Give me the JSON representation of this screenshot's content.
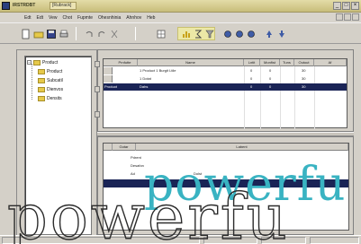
{
  "window": {
    "app_title": "IRSTRDBT",
    "doc_title": "[Rubrack]",
    "min_glyph": "_",
    "max_glyph": "□",
    "close_glyph": "×"
  },
  "menu": {
    "items": [
      "Edt",
      "Edt",
      "Vew",
      "Chot",
      "Fupmte",
      "Ohesnhinia",
      "Ahnhov",
      "Heb"
    ]
  },
  "tree": {
    "root": "Product",
    "children": [
      "Product",
      "Subcatil",
      "Dienvos",
      "Densits"
    ]
  },
  "grid": {
    "columns": [
      "Prnfutte",
      "Name",
      "Lntit",
      "Monfist",
      "Tuns",
      "Outout",
      "Af"
    ],
    "rows": [
      {
        "name": "1 Product 1 Burgit Ltile",
        "c1": "0",
        "c2": "0",
        "c3": "",
        "c4": "30",
        "c5": "",
        "selected": false
      },
      {
        "name": "1 Dotat",
        "c1": "0",
        "c2": "0",
        "c3": "",
        "c4": "30",
        "c5": "",
        "selected": false
      },
      {
        "name": "Dahs",
        "c1": "0",
        "c2": "0",
        "c3": "",
        "c4": "30",
        "c5": "",
        "selected": true
      }
    ],
    "row_marker_selected": "Produot"
  },
  "lower": {
    "columns": [
      "Gotar",
      "Labent"
    ],
    "rows": [
      {
        "a": "Pdrent",
        "b": "",
        "selected": false
      },
      {
        "a": "Desafon",
        "b": "",
        "selected": false
      },
      {
        "a": "Ad",
        "b": "Dolst",
        "selected": false
      },
      {
        "a": "",
        "b": "",
        "selected": true
      }
    ]
  },
  "watermark": {
    "word_top": "powerfu",
    "word_bottom": "powerfu"
  },
  "colors": {
    "selection": "#1a2456",
    "watermark_cyan": "#39b3c2",
    "titlebar": "#d9d09a"
  }
}
